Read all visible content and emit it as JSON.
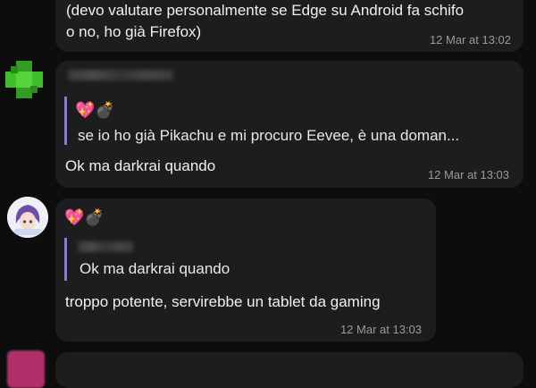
{
  "messages": [
    {
      "text": "(devo valutare personalmente se Edge su Android fa schifo\no no, ho già Firefox)",
      "time": "12 Mar at 13:02"
    },
    {
      "sender_emojis": "💖💣",
      "quote_text": "se io ho già Pikachu e mi procuro Eevee, è una doman...",
      "text": "Ok ma darkrai quando",
      "time": "12 Mar at 13:03",
      "avatar_color": "#3fbf2e"
    },
    {
      "sender_emojis": "💖💣",
      "quote_text": "Ok ma darkrai quando",
      "text": "troppo potente, servirebbe un tablet da gaming",
      "time": "12 Mar at 13:03",
      "avatar_color": "#e8e8f4"
    }
  ],
  "colors": {
    "background": "#0d0d0d",
    "bubble": "#1d1d1f",
    "quote_bar": "#8e7cc3",
    "timestamp": "#9a9a9a"
  }
}
